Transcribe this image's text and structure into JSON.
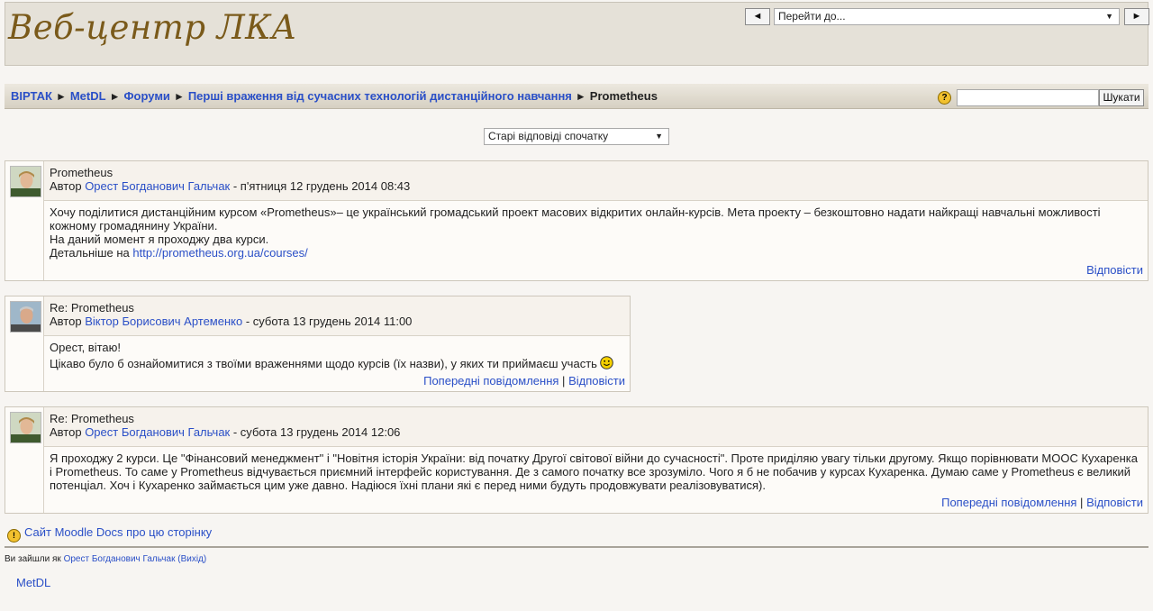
{
  "header": {
    "site_title": "Веб-центр ЛКА",
    "prev_arrow": "◄",
    "next_arrow": "►",
    "jump_select": "Перейти до..."
  },
  "navbar": {
    "breadcrumbs": [
      "ВІРТАК",
      "MetDL",
      "Форуми",
      "Перші враження від сучасних технологій дистанційного навчання"
    ],
    "current": "Prometheus",
    "separator": "►",
    "help_icon": "?",
    "search_placeholder": "",
    "search_button": "Шукати"
  },
  "sort": {
    "selected": "Старі відповіді спочатку"
  },
  "posts": [
    {
      "subject": "Prometheus",
      "author_prefix": "Автор",
      "author": "Орест Богданович Гальчак",
      "date": " - п'ятниця 12 грудень 2014 08:43",
      "body": [
        "Хочу поділитися дистанційним курсом «Prometheus»– це український громадський проект масових відкритих онлайн-курсів. Мета проекту – безкоштовно надати найкращі навчальні можливості кожному громадянину України.",
        "На даний момент я проходжу два курси."
      ],
      "more_prefix": "Детальніше на ",
      "link": "http://prometheus.org.ua/courses/",
      "reply": "Відповісти"
    },
    {
      "subject": "Re: Prometheus",
      "author_prefix": "Автор",
      "author": "Віктор Борисович Артеменко",
      "date": " - субота 13 грудень 2014 11:00",
      "body": [
        "Орест, вітаю!",
        "Цікаво було б ознайомитися з твоїми враженнями щодо курсів (їх назви), у яких ти приймаєш участь"
      ],
      "parent": "Попередні повідомлення",
      "divider": "|",
      "reply": "Відповісти"
    },
    {
      "subject": "Re: Prometheus",
      "author_prefix": "Автор",
      "author": "Орест Богданович Гальчак",
      "date": " - субота 13 грудень 2014 12:06",
      "body": [
        "Я проходжу 2 курси. Це \"Фінансовий менеджмент\" і \"Новітня історія України: від початку Другої світової війни до сучасності\". Проте приділяю увагу тільки другому. Якщо порівнювати MOOC Кухаренка і Prometheus. То саме у Prometheus відчувається приємний інтерфейс користування. Де з самого початку все зрозуміло. Чого я б не побачив у курсах Кухаренка. Думаю саме у Prometheus є великий потенціал. Хоч і Кухаренко займається цим уже давно. Надіюся їхні плани які є перед ними будуть продовжувати реалізовуватися)."
      ],
      "parent": "Попередні повідомлення",
      "divider": "|",
      "reply": "Відповісти"
    }
  ],
  "footer": {
    "docs_link": "Сайт Moodle Docs про цю сторінку",
    "login_prefix": "Ви зайшли як ",
    "login_user": "Орест Богданович Гальчак",
    "logout": "(Вихід)",
    "home_link": "MetDL"
  }
}
